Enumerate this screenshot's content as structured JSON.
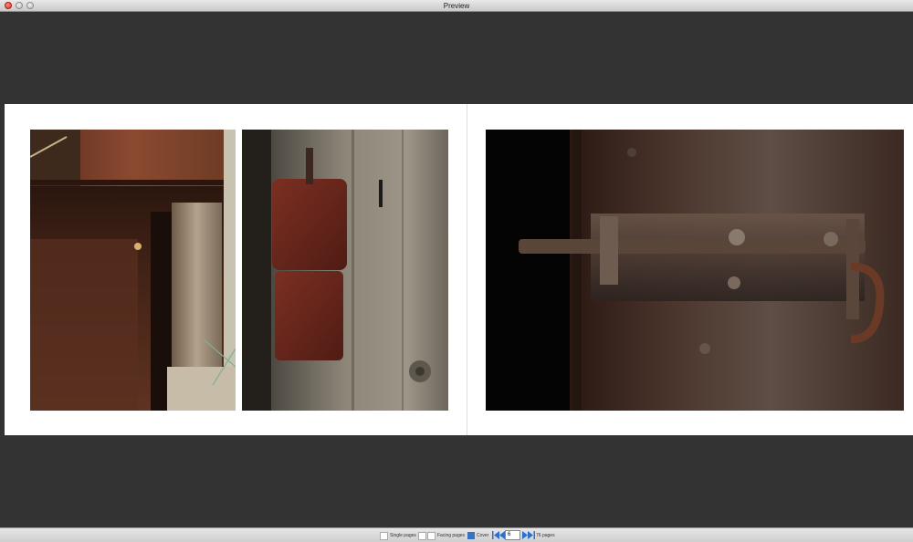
{
  "window": {
    "title": "Preview"
  },
  "toolbar": {
    "single_pages_label": "Single pages",
    "facing_pages_label": "Facing pages",
    "cover_label": "Cover",
    "current_page": "6",
    "pages_count": "76 pages"
  },
  "colors": {
    "canvas_background": "#333333",
    "page_background": "#ffffff",
    "cover_icon": "#3a72c2",
    "nav_icon": "#2f6fc9"
  },
  "icons": {
    "close": "close-icon",
    "minimize": "minimize-icon",
    "zoom": "zoom-icon",
    "first_page": "first-page-icon",
    "previous_page": "previous-page-icon",
    "next_page": "next-page-icon",
    "last_page": "last-page-icon"
  }
}
